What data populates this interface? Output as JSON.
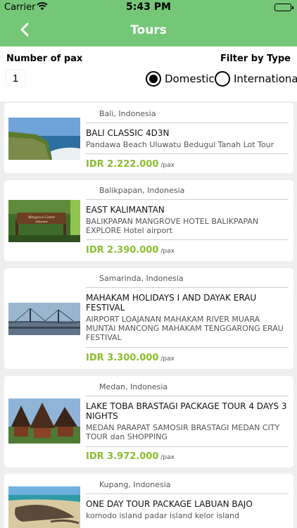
{
  "status_bar": {
    "carrier": "Carrier",
    "time": "5:43 PM"
  },
  "nav": {
    "title": "Tours",
    "back_icon": "chevron-left-icon"
  },
  "filters": {
    "pax_label": "Number of pax",
    "pax_value": "1",
    "type_label": "Filter by Type",
    "options": [
      {
        "label": "Domestic",
        "selected": true
      },
      {
        "label": "International",
        "selected": false
      }
    ]
  },
  "tours": [
    {
      "location": "Bali, Indonesia",
      "name": "BALI CLASSIC 4D3N",
      "description": "Pandawa Beach Uluwatu Bedugul Tanah Lot Tour",
      "price": "IDR 2.222.000",
      "unit": "/pax"
    },
    {
      "location": "Balikpapan, Indonesia",
      "name": "EAST KALIMANTAN",
      "description": "BALIKPAPAN MANGROVE HOTEL BALIKPAPAN EXPLORE Hotel airport",
      "price": "IDR 2.390.000",
      "unit": "/pax",
      "sign_text": "Mangrove Center Balikpapan"
    },
    {
      "location": "Samarinda, Indonesia",
      "name": "MAHAKAM HOLIDAYS I AND DAYAK ERAU FESTIVAL",
      "description": "AIRPORT LOAJANAN MAHAKAM RIVER MUARA MUNTAI MANCONG MAHAKAM TENGGARONG ERAU FESTIVAL",
      "price": "IDR 3.300.000",
      "unit": "/pax"
    },
    {
      "location": "Medan, Indonesia",
      "name": "LAKE TOBA  BRASTAGI PACKAGE TOUR 4 DAYS 3 NIGHTS",
      "description": "MEDAN PARAPAT SAMOSIR BRASTAGI MEDAN CITY TOUR dan SHOPPING",
      "price": "IDR 3.972.000",
      "unit": "/pax"
    },
    {
      "location": "Kupang, Indonesia",
      "name": "ONE DAY TOUR PACKAGE LABUAN BAJO",
      "description": "komodo island padar island kelor island",
      "price": "",
      "unit": ""
    }
  ]
}
